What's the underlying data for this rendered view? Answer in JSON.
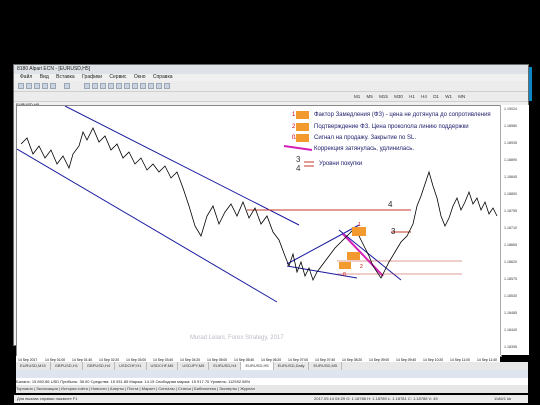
{
  "brand": {
    "logo_text": "alpari",
    "accent": "#0b86c7"
  },
  "window": {
    "title": "8180 Alpari ECN - [EURUSD,H5]",
    "menu": [
      "Файл",
      "Вид",
      "Вставка",
      "Графики",
      "Сервис",
      "Окно",
      "Справка"
    ],
    "timeframes": [
      "M1",
      "M5",
      "M15",
      "M30",
      "H1",
      "H4",
      "D1",
      "W1",
      "MN"
    ]
  },
  "chart": {
    "symbol": "EURUSD,H5",
    "price_labels": [
      "1.19024",
      "1.18980",
      "1.18935",
      "1.18890",
      "1.18845",
      "1.18800",
      "1.18755",
      "1.18710",
      "1.18665",
      "1.18620",
      "1.18575",
      "1.18530",
      "1.18485",
      "1.18440",
      "1.18395"
    ],
    "time_labels": [
      "14 Sep 2017",
      "14 Sep 01:00",
      "14 Sep 01:40",
      "14 Sep 02:20",
      "14 Sep 03:00",
      "14 Sep 03:40",
      "14 Sep 04:20",
      "14 Sep 05:00",
      "14 Sep 05:40",
      "14 Sep 06:20",
      "14 Sep 07:00",
      "14 Sep 07:40",
      "14 Sep 08:20",
      "14 Sep 09:00",
      "14 Sep 09:40",
      "14 Sep 10:20",
      "14 Sep 11:00",
      "14 Sep 11:40"
    ],
    "annotations": {
      "n4": "4",
      "n3": "3",
      "n1": "1",
      "n2": "2",
      "arrow": "ß"
    }
  },
  "legend": {
    "item1_num": "1",
    "item1": "Фактор Замедления (ФЗ) - цена не дотянула до сопротивления",
    "item2_num": "2",
    "item2": "Подтверждение ФЗ. Цена проколола линию поддержки",
    "item_b_num": "ß",
    "item_b": "Сигнал на продажу. Закрытие по SL.",
    "item_line": "Коррекция затянулась, удлинилась.",
    "item34_nums": "3\n4",
    "item34": "Уровни покупки"
  },
  "tabs": [
    "EURUSD,M15",
    "GBPUSD,H1",
    "GBPUSD,H4",
    "USDCHF,H1",
    "USDCHF,M5",
    "USDJPY,M5",
    "EURUSD,H4",
    "EURUSD,H5",
    "EURUSD,Daily",
    "EURUSD,M5"
  ],
  "terminal": {
    "row": "Баланс: 15 892.86 USD  Прибыль: 38.00  Средства: 15 931.85  Маржа: 14.15  Свободная маржа: 15 917.70  Уровень: 112592.58%",
    "tabs": "Торговля | Экспозиция | История счёта | Новости | Алерты | Почта | Маркет | Сигналы | Статьи | Библиотека | Эксперты | Журнал"
  },
  "status": {
    "left": "Для вызова справки нажмите F1",
    "mid": "2017.09.14 04:29   O: 1.18786   H: 1.18789   L: 1.18781   C: 1.18786   V: 45",
    "right": "1186/1 kb"
  },
  "watermark": "Murad Lelani, Forex Strategy, 2017"
}
